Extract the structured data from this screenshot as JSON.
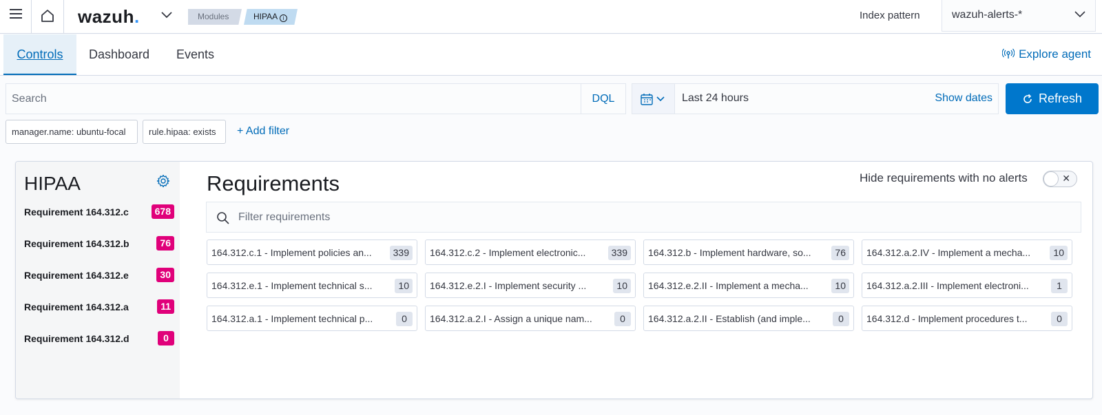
{
  "header": {
    "logo_text": "wazuh",
    "logo_dot": ".",
    "breadcrumbs": [
      "Modules",
      "HIPAA"
    ],
    "index_pattern_label": "Index pattern",
    "index_pattern_value": "wazuh-alerts-*"
  },
  "tabs": [
    {
      "label": "Controls",
      "active": true
    },
    {
      "label": "Dashboard",
      "active": false
    },
    {
      "label": "Events",
      "active": false
    }
  ],
  "explore_agent": "Explore agent",
  "search": {
    "placeholder": "Search",
    "language": "DQL",
    "date_range": "Last 24 hours",
    "show_dates": "Show dates",
    "refresh": "Refresh"
  },
  "filters": {
    "pills": [
      "manager.name: ubuntu-focal",
      "rule.hipaa: exists"
    ],
    "add_filter": "+ Add filter"
  },
  "sidebar": {
    "title": "HIPAA",
    "requirements": [
      {
        "label": "Requirement 164.312.c",
        "count": "678"
      },
      {
        "label": "Requirement 164.312.b",
        "count": "76"
      },
      {
        "label": "Requirement 164.312.e",
        "count": "30"
      },
      {
        "label": "Requirement 164.312.a",
        "count": "11"
      },
      {
        "label": "Requirement 164.312.d",
        "count": "0"
      }
    ]
  },
  "main": {
    "title": "Requirements",
    "hide_label": "Hide requirements with no alerts",
    "filter_placeholder": "Filter requirements",
    "cards": [
      {
        "text": "164.312.c.1 - Implement policies an...",
        "count": "339"
      },
      {
        "text": "164.312.c.2 - Implement electronic...",
        "count": "339"
      },
      {
        "text": "164.312.b - Implement hardware, so...",
        "count": "76"
      },
      {
        "text": "164.312.a.2.IV - Implement a mecha...",
        "count": "10"
      },
      {
        "text": "164.312.e.1 - Implement technical s...",
        "count": "10"
      },
      {
        "text": "164.312.e.2.I - Implement security ...",
        "count": "10"
      },
      {
        "text": "164.312.e.2.II - Implement a mecha...",
        "count": "10"
      },
      {
        "text": "164.312.a.2.III - Implement electroni...",
        "count": "1"
      },
      {
        "text": "164.312.a.1 - Implement technical p...",
        "count": "0"
      },
      {
        "text": "164.312.a.2.I - Assign a unique nam...",
        "count": "0"
      },
      {
        "text": "164.312.a.2.II - Establish (and imple...",
        "count": "0"
      },
      {
        "text": "164.312.d - Implement procedures t...",
        "count": "0"
      }
    ]
  },
  "colors": {
    "accent": "#006bb8",
    "primary_button": "#0077cc",
    "count_badge": "#e0007a"
  }
}
